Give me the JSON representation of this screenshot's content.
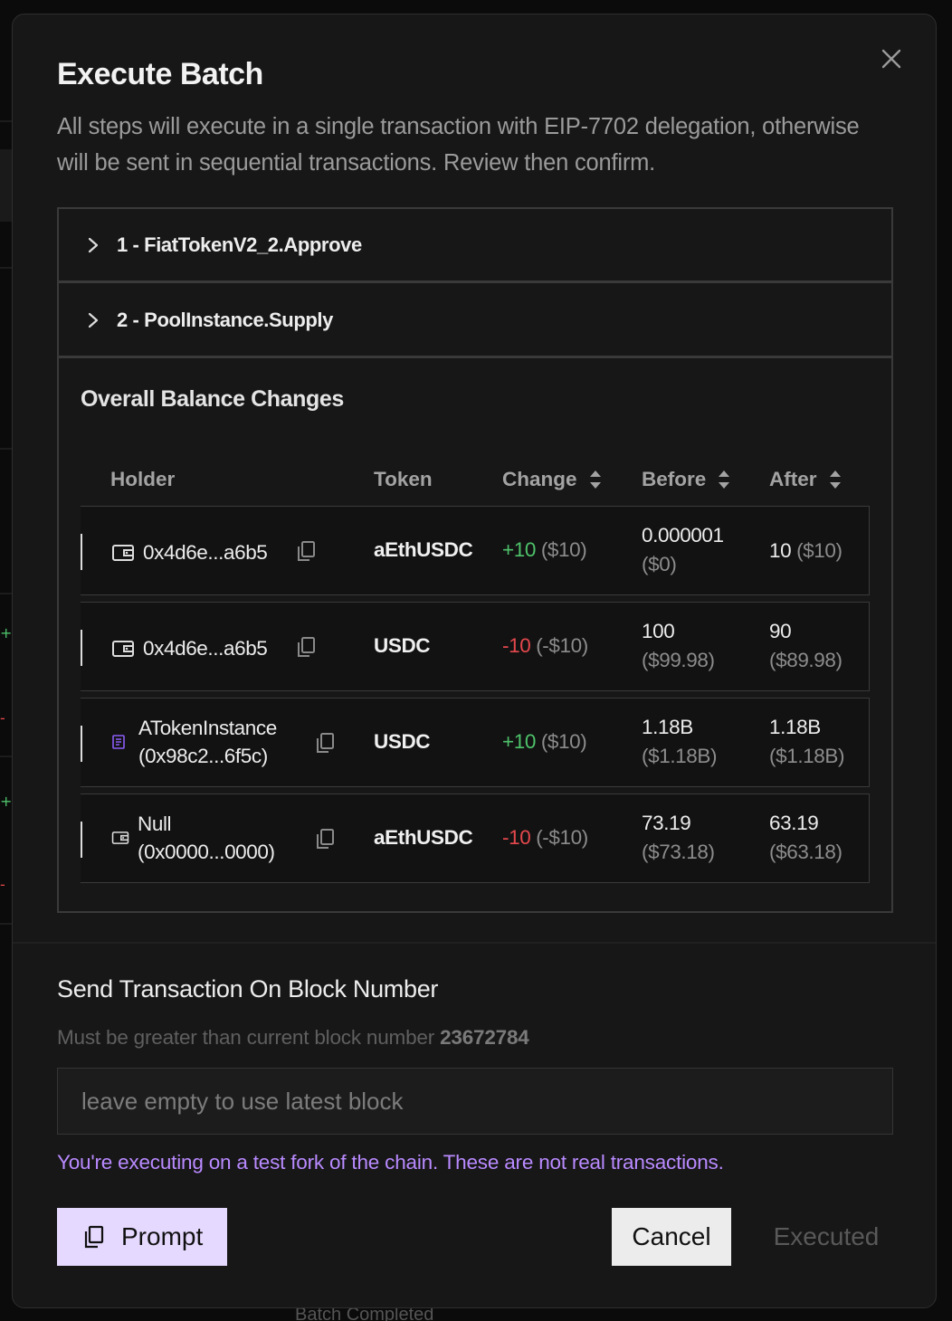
{
  "modal": {
    "title": "Execute Batch",
    "description": "All steps will execute in a single transaction with EIP-7702 delegation, otherwise will be sent in sequential transactions. Review then confirm."
  },
  "steps": [
    {
      "label": "1 - FiatTokenV2_2.Approve"
    },
    {
      "label": "2 - PoolInstance.Supply"
    }
  ],
  "balance_changes": {
    "title": "Overall Balance Changes",
    "columns": {
      "holder": "Holder",
      "token": "Token",
      "change": "Change",
      "before": "Before",
      "after": "After"
    },
    "rows": [
      {
        "holder_icon": "wallet-icon",
        "holder_line1": "0x4d6e...a6b5",
        "holder_line2": "",
        "token": "aEthUSDC",
        "change_value": "+10",
        "change_usd": "($10)",
        "change_sign": "pos",
        "before_value": "0.000001",
        "before_usd": "($0)",
        "after_value": "10",
        "after_usd": "($10)",
        "after_inline": true
      },
      {
        "holder_icon": "wallet-icon",
        "holder_line1": "0x4d6e...a6b5",
        "holder_line2": "",
        "token": "USDC",
        "change_value": "-10",
        "change_usd": "(-$10)",
        "change_sign": "neg",
        "before_value": "100",
        "before_usd": "($99.98)",
        "after_value": "90",
        "after_usd": "($89.98)",
        "after_inline": false
      },
      {
        "holder_icon": "contract-icon",
        "holder_line1": "ATokenInstance",
        "holder_line2": "(0x98c2...6f5c)",
        "token": "USDC",
        "change_value": "+10",
        "change_usd": "($10)",
        "change_sign": "pos",
        "before_value": "1.18B",
        "before_usd": "($1.18B)",
        "after_value": "1.18B",
        "after_usd": "($1.18B)",
        "after_inline": false
      },
      {
        "holder_icon": "wallet-icon",
        "holder_line1": "Null",
        "holder_line2": "(0x0000...0000)",
        "token": "aEthUSDC",
        "change_value": "-10",
        "change_usd": "(-$10)",
        "change_sign": "neg",
        "before_value": "73.19",
        "before_usd": "($73.18)",
        "after_value": "63.19",
        "after_usd": "($63.18)",
        "after_inline": false
      }
    ]
  },
  "send": {
    "label": "Send Transaction On Block Number",
    "hint_prefix": "Must be greater than current block number",
    "current_block": "23672784",
    "input_value": "",
    "input_placeholder": "leave empty to use latest block",
    "warning": "You're executing on a test fork of the chain. These are not real transactions."
  },
  "buttons": {
    "prompt": "Prompt",
    "cancel": "Cancel",
    "executed": "Executed"
  },
  "background": {
    "peek_text": "Batch Completed"
  },
  "colors": {
    "accent": "#b98aff",
    "positive": "#4ec26a",
    "negative": "#e5484d",
    "prompt_bg": "#e6d9ff",
    "modal_bg": "#171717"
  }
}
